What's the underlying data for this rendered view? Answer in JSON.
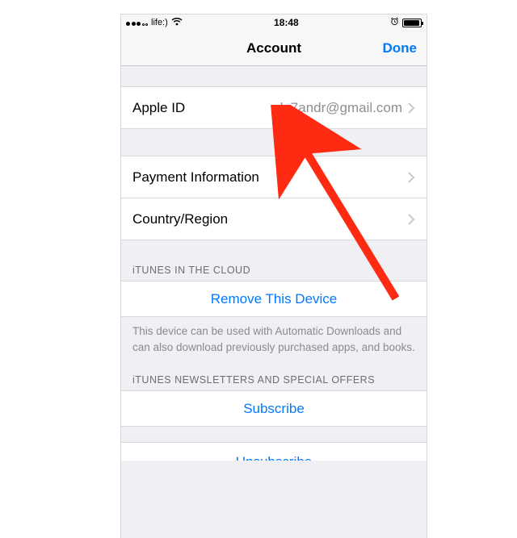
{
  "statusBar": {
    "carrier": "life:)",
    "time": "18:48"
  },
  "navBar": {
    "title": "Account",
    "done": "Done"
  },
  "appleIdRow": {
    "label": "Apple ID",
    "value": "le7andr@gmail.com"
  },
  "paymentRow": {
    "label": "Payment Information"
  },
  "countryRow": {
    "label": "Country/Region"
  },
  "cloudSection": {
    "header": "iTUNES IN THE CLOUD",
    "removeDevice": "Remove This Device",
    "footer": "This device can be used with Automatic Downloads and can also download previously purchased apps, and books."
  },
  "newsletterSection": {
    "header": "iTUNES NEWSLETTERS AND SPECIAL OFFERS",
    "subscribe": "Subscribe",
    "unsubscribe": "Unsubscribe"
  },
  "colors": {
    "tint": "#007aff",
    "groupBg": "#efeff4"
  }
}
